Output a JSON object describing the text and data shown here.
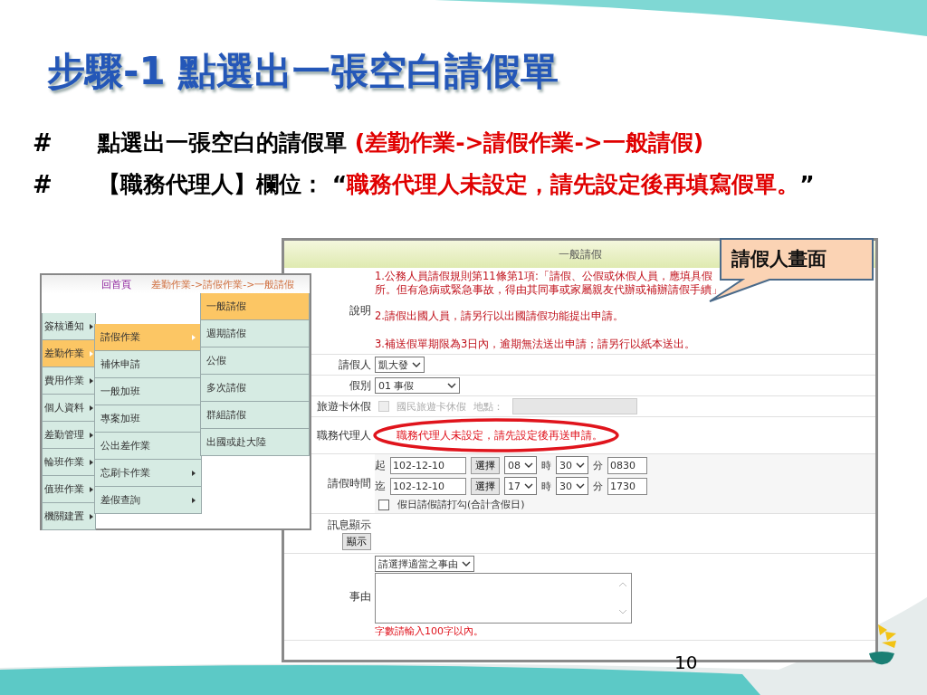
{
  "slide": {
    "title": "步驟-1  點選出一張空白請假單",
    "page_number": "10",
    "callout": "請假人畫面"
  },
  "bullets": [
    {
      "marker": "#",
      "segments": [
        {
          "text": "點選出一張空白的請假單 ",
          "highlight": false
        },
        {
          "text": "(差勤作業->請假作業->一般請假)",
          "highlight": true
        }
      ]
    },
    {
      "marker": "#",
      "segments": [
        {
          "text": "【職務代理人】欄位：  “",
          "highlight": false
        },
        {
          "text": "職務代理人未設定，請先設定後再填寫假單。",
          "highlight": true
        },
        {
          "text": "”",
          "highlight": false
        }
      ]
    }
  ],
  "menu_screenshot": {
    "home_link": "回首頁",
    "breadcrumb": "差勤作業->請假作業->一般請假",
    "main_menu": [
      {
        "label": "簽核通知",
        "selected": false,
        "has_children": true
      },
      {
        "label": "差勤作業",
        "selected": true,
        "has_children": true
      },
      {
        "label": "費用作業",
        "selected": false,
        "has_children": true
      },
      {
        "label": "個人資料",
        "selected": false,
        "has_children": true
      },
      {
        "label": "差勤管理",
        "selected": false,
        "has_children": true
      },
      {
        "label": "輪班作業",
        "selected": false,
        "has_children": true
      },
      {
        "label": "值班作業",
        "selected": false,
        "has_children": true
      },
      {
        "label": "機關建置",
        "selected": false,
        "has_children": true
      }
    ],
    "submenu": [
      {
        "label": "請假作業",
        "selected": true,
        "has_children": true
      },
      {
        "label": "補休申請",
        "selected": false,
        "has_children": false
      },
      {
        "label": "一般加班",
        "selected": false,
        "has_children": false
      },
      {
        "label": "專案加班",
        "selected": false,
        "has_children": false
      },
      {
        "label": "公出差作業",
        "selected": false,
        "has_children": false
      },
      {
        "label": "忘刷卡作業",
        "selected": false,
        "has_children": true
      },
      {
        "label": "差假查詢",
        "selected": false,
        "has_children": true
      }
    ],
    "leaf_menu": [
      {
        "label": "一般請假",
        "selected": true
      },
      {
        "label": "週期請假",
        "selected": false
      },
      {
        "label": "公假",
        "selected": false
      },
      {
        "label": "多次請假",
        "selected": false
      },
      {
        "label": "群組請假",
        "selected": false
      },
      {
        "label": "出國或赴大陸",
        "selected": false
      }
    ]
  },
  "form_screenshot": {
    "title": "一般請假",
    "notes_label": "說明",
    "notes": [
      "1.公務人員請假規則第11條第1項:「請假、公假或休假人員，應填具假",
      "所。但有急病或緊急事故，得由其同事或家屬親友代辦或補辦請假手續」",
      "2.請假出國人員，請另行以出國請假功能提出申請。",
      "3.補送假單期限為3日內，逾期無法送出申請；請另行以紙本送出。"
    ],
    "applicant": {
      "label": "請假人",
      "value": "凱大發"
    },
    "leave_type": {
      "label": "假別",
      "value": "01 事假"
    },
    "travel_card": {
      "label": "旅遊卡休假",
      "checkbox_label": "國民旅遊卡休假",
      "location_label": "地點：",
      "checked": false,
      "disabled": true
    },
    "deputy": {
      "label": "職務代理人",
      "message": "職務代理人未設定，請先設定後再送申請。"
    },
    "leave_time": {
      "label": "請假時間",
      "rows": [
        {
          "prefix": "起",
          "date": "102-12-10",
          "pick_button": "選擇",
          "hour": "08",
          "hour_unit": "時",
          "minute": "30",
          "minute_unit": "分",
          "time": "0830"
        },
        {
          "prefix": "迄",
          "date": "102-12-10",
          "pick_button": "選擇",
          "hour": "17",
          "hour_unit": "時",
          "minute": "30",
          "minute_unit": "分",
          "time": "1730"
        }
      ],
      "holiday": {
        "label": "假日請假請打勾(合計含假日)",
        "checked": false
      }
    },
    "message": {
      "label": "訊息顯示",
      "button": "顯示"
    },
    "reason": {
      "label": "事由",
      "select": "請選擇適當之事由",
      "hint": "字數請輸入100字以內。"
    }
  }
}
